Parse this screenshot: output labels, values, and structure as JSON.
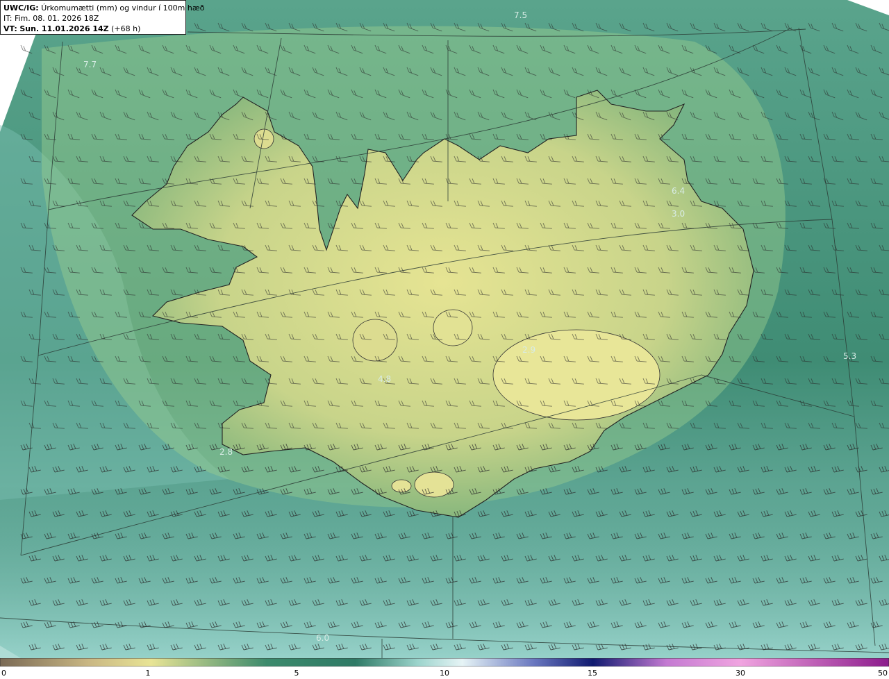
{
  "header": {
    "model": "UWC/IG:",
    "title": "Úrkomumætti (mm) og vindur í 100m hæð",
    "it_label": "IT:",
    "it_value": "Fim. 08. 01. 2026 18Z",
    "vt_label": "VT:",
    "vt_value": "Sun. 11.01.2026 14Z",
    "vt_lead": "(+68 h)"
  },
  "colorbar": {
    "ticks": [
      "0",
      "1",
      "5",
      "10",
      "15",
      "30",
      "50"
    ],
    "colors": [
      "#7a6a55",
      "#c9b783",
      "#e8e495",
      "#3c8a6c",
      "#2f7a66",
      "#9cd4cc",
      "#e6f4f6",
      "#6a78c0",
      "#101a70",
      "#c47ad2",
      "#f0a4e0",
      "#8c1c8c"
    ]
  },
  "map_labels": [
    "7.5",
    "7.7",
    "6.4",
    "3.0",
    "5.3",
    "4.8",
    "2.8",
    "6.0",
    "2.9"
  ]
}
